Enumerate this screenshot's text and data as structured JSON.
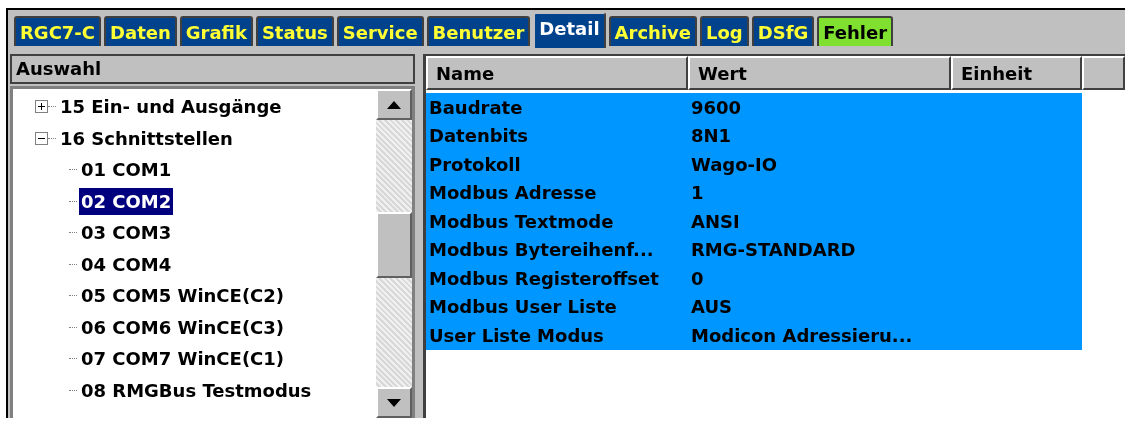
{
  "tabs": [
    {
      "label": "RGC7-C",
      "selected": false,
      "kind": "normal"
    },
    {
      "label": "Daten",
      "selected": false,
      "kind": "normal"
    },
    {
      "label": "Grafik",
      "selected": false,
      "kind": "normal"
    },
    {
      "label": "Status",
      "selected": false,
      "kind": "normal"
    },
    {
      "label": "Service",
      "selected": false,
      "kind": "normal"
    },
    {
      "label": "Benutzer",
      "selected": false,
      "kind": "normal"
    },
    {
      "label": "Detail",
      "selected": true,
      "kind": "normal"
    },
    {
      "label": "Archive",
      "selected": false,
      "kind": "normal"
    },
    {
      "label": "Log",
      "selected": false,
      "kind": "normal"
    },
    {
      "label": "DSfG",
      "selected": false,
      "kind": "normal"
    },
    {
      "label": "Fehler",
      "selected": false,
      "kind": "alert"
    }
  ],
  "tree": {
    "title": "Auswahl",
    "items": [
      {
        "label": "15 Ein- und Ausgänge",
        "expanded": false,
        "selected": false
      },
      {
        "label": "16 Schnittstellen",
        "expanded": true,
        "selected": false,
        "children": [
          {
            "label": "01 COM1",
            "selected": false
          },
          {
            "label": "02 COM2",
            "selected": true
          },
          {
            "label": "03 COM3",
            "selected": false
          },
          {
            "label": "04 COM4",
            "selected": false
          },
          {
            "label": "05 COM5 WinCE(C2)",
            "selected": false
          },
          {
            "label": "06 COM6 WinCE(C3)",
            "selected": false
          },
          {
            "label": "07 COM7 WinCE(C1)",
            "selected": false
          },
          {
            "label": "08 RMGBus Testmodus",
            "selected": false
          }
        ]
      }
    ]
  },
  "table": {
    "columns": [
      "Name",
      "Wert",
      "Einheit"
    ],
    "rows": [
      {
        "name": "Baudrate",
        "value": "9600",
        "selected": true
      },
      {
        "name": "Datenbits",
        "value": "8N1",
        "selected": true
      },
      {
        "name": "Protokoll",
        "value": "Wago-IO",
        "selected": true
      },
      {
        "name": "Modbus Adresse",
        "value": "1",
        "selected": true
      },
      {
        "name": "Modbus Textmode",
        "value": "ANSI",
        "selected": true
      },
      {
        "name": "Modbus Bytereihenf...",
        "value": "RMG-STANDARD",
        "selected": true
      },
      {
        "name": "Modbus Registeroffset",
        "value": "0",
        "selected": true
      },
      {
        "name": "Modbus User Liste",
        "value": "AUS",
        "selected": true
      },
      {
        "name": "User Liste Modus",
        "value": "Modicon Adressieru...",
        "selected": true
      }
    ]
  }
}
